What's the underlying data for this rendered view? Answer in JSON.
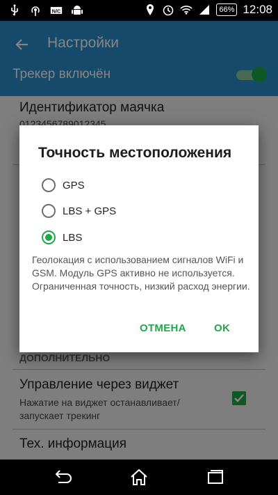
{
  "status_bar": {
    "left_icons": [
      "usb-icon",
      "hotspot-icon",
      "nfc-icon",
      "android-icon"
    ],
    "right_icons": [
      "location-icon",
      "alarm-icon",
      "wifi-icon",
      "signal-icon"
    ],
    "battery": "66%",
    "time": "12:08"
  },
  "app_bar": {
    "title": "Настройки",
    "tracker_label": "Трекер включён",
    "tracker_enabled": true
  },
  "settings": {
    "beacon_id_title": "Идентификатор маячка",
    "beacon_id_value": "0123456789012345",
    "section_advanced": "ДОПОЛНИТЕЛЬНО",
    "widget_title": "Управление через виджет",
    "widget_sub_line1": "Нажатие на виджет останавливает/",
    "widget_sub_line2": "запускает трекинг",
    "widget_checked": true,
    "tech_info_title": "Тех. информация"
  },
  "dialog": {
    "title": "Точность местоположения",
    "options": [
      {
        "label": "GPS",
        "selected": false
      },
      {
        "label": "LBS + GPS",
        "selected": false
      },
      {
        "label": "LBS",
        "selected": true
      }
    ],
    "description": "Геолокация с использованием сигналов WiFi и GSM. Модуль GPS активно не используется. Ограниченная точность, низкий расход энергии.",
    "cancel_label": "ОТМЕНА",
    "ok_label": "OK"
  },
  "colors": {
    "accent": "#1fa84a",
    "app_bar": "#2b8fcb"
  }
}
